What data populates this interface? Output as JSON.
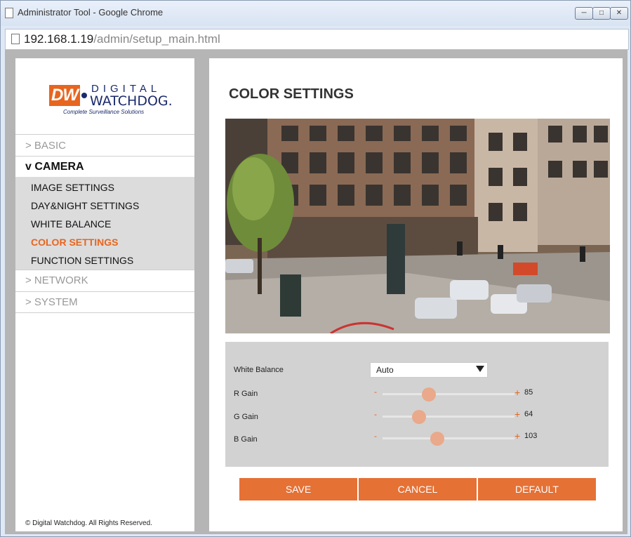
{
  "window": {
    "title": "Administrator Tool - Google Chrome",
    "controls": [
      "minimize",
      "maximize",
      "close"
    ]
  },
  "address": {
    "host": "192.168.1.19",
    "path": "/admin/setup_main.html"
  },
  "logo": {
    "mark": "DW",
    "line1": "DIGITAL",
    "line2": "WATCHDOG.",
    "tagline": "Complete Surveillance Solutions"
  },
  "nav": {
    "basic": "> BASIC",
    "camera": "v CAMERA",
    "camera_items": [
      {
        "label": "IMAGE SETTINGS",
        "active": false
      },
      {
        "label": "DAY&NIGHT SETTINGS",
        "active": false
      },
      {
        "label": "WHITE BALANCE",
        "active": false
      },
      {
        "label": "COLOR SETTINGS",
        "active": true
      },
      {
        "label": "FUNCTION SETTINGS",
        "active": false
      }
    ],
    "network": "> NETWORK",
    "system": "> SYSTEM"
  },
  "footer": {
    "copyright": "© Digital Watchdog. All Rights Reserved."
  },
  "main": {
    "title": "COLOR SETTINGS",
    "white_balance": {
      "label": "White Balance",
      "value": "Auto"
    },
    "sliders": [
      {
        "label": "R Gain",
        "minus": "-",
        "plus": "+",
        "value": 85
      },
      {
        "label": "G Gain",
        "minus": "-",
        "plus": "+",
        "value": 64
      },
      {
        "label": "B Gain",
        "minus": "-",
        "plus": "+",
        "value": 103
      }
    ],
    "buttons": {
      "save": "SAVE",
      "cancel": "CANCEL",
      "default": "DEFAULT"
    }
  },
  "colors": {
    "accent": "#e8651e",
    "button": "#e57135",
    "panel": "#d2d2d2"
  }
}
